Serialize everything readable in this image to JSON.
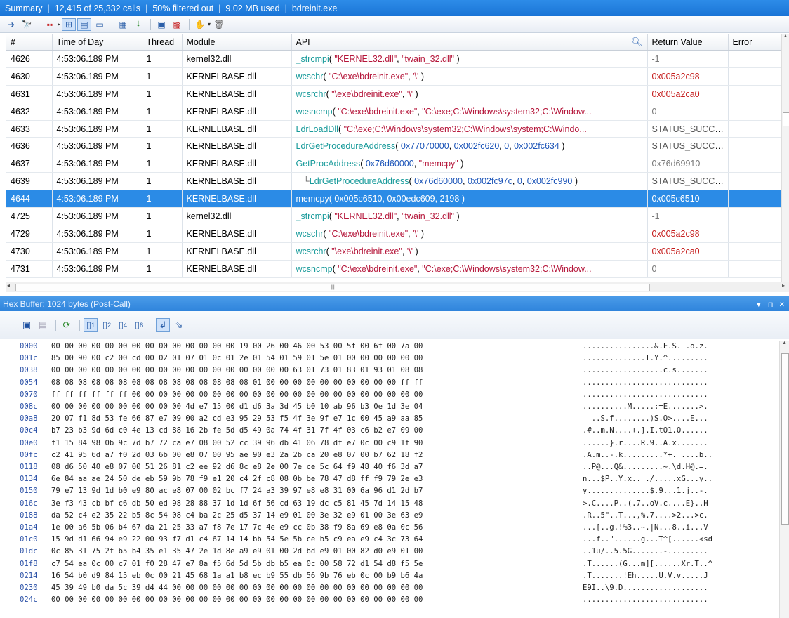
{
  "summary": {
    "label": "Summary",
    "calls": "12,415 of 25,332 calls",
    "filtered": "50% filtered out",
    "memory": "9.02 MB used",
    "process": "bdreinit.exe"
  },
  "columns": [
    "#",
    "Time of Day",
    "Thread",
    "Module",
    "API",
    "Return Value",
    "Error"
  ],
  "rows": [
    {
      "n": "4626",
      "time": "4:53:06.189 PM",
      "thread": "1",
      "module": "kernel32.dll",
      "fn": "_strcmpi",
      "args": [
        {
          "t": "( ",
          "k": "p"
        },
        {
          "t": "\"KERNEL32.dll\"",
          "k": "s"
        },
        {
          "t": ", ",
          "k": "p"
        },
        {
          "t": "\"twain_32.dll\"",
          "k": "s"
        },
        {
          "t": " )",
          "k": "p"
        }
      ],
      "ret": "-1",
      "retk": "d"
    },
    {
      "n": "4630",
      "time": "4:53:06.189 PM",
      "thread": "1",
      "module": "KERNELBASE.dll",
      "fn": "wcschr",
      "args": [
        {
          "t": "( ",
          "k": "p"
        },
        {
          "t": "\"C:\\exe\\bdreinit.exe\"",
          "k": "s"
        },
        {
          "t": ", ",
          "k": "p"
        },
        {
          "t": "'\\'",
          "k": "s"
        },
        {
          "t": " )",
          "k": "p"
        }
      ],
      "ret": "0x005a2c98",
      "retk": "h"
    },
    {
      "n": "4631",
      "time": "4:53:06.189 PM",
      "thread": "1",
      "module": "KERNELBASE.dll",
      "fn": "wcsrchr",
      "args": [
        {
          "t": "( ",
          "k": "p"
        },
        {
          "t": "\"\\exe\\bdreinit.exe\"",
          "k": "s"
        },
        {
          "t": ", ",
          "k": "p"
        },
        {
          "t": "'\\'",
          "k": "s"
        },
        {
          "t": " )",
          "k": "p"
        }
      ],
      "ret": "0x005a2ca0",
      "retk": "h"
    },
    {
      "n": "4632",
      "time": "4:53:06.189 PM",
      "thread": "1",
      "module": "KERNELBASE.dll",
      "fn": "wcsncmp",
      "args": [
        {
          "t": "( ",
          "k": "p"
        },
        {
          "t": "\"C:\\exe\\bdreinit.exe\"",
          "k": "s"
        },
        {
          "t": ", ",
          "k": "p"
        },
        {
          "t": "\"C:\\exe;C:\\Windows\\system32;C:\\Window...",
          "k": "s"
        }
      ],
      "ret": "0",
      "retk": "d"
    },
    {
      "n": "4633",
      "time": "4:53:06.189 PM",
      "thread": "1",
      "module": "KERNELBASE.dll",
      "fn": "LdrLoadDll",
      "args": [
        {
          "t": "( ",
          "k": "p"
        },
        {
          "t": "\"C:\\exe;C:\\Windows\\system32;C:\\Windows\\system;C:\\Windo...",
          "k": "s"
        }
      ],
      "ret": "STATUS_SUCCESS",
      "retk": "o"
    },
    {
      "n": "4636",
      "time": "4:53:06.189 PM",
      "thread": "1",
      "module": "KERNELBASE.dll",
      "fn": "LdrGetProcedureAddress",
      "args": [
        {
          "t": "( ",
          "k": "p"
        },
        {
          "t": "0x77070000",
          "k": "n"
        },
        {
          "t": ", ",
          "k": "p"
        },
        {
          "t": "0x002fc620",
          "k": "n"
        },
        {
          "t": ", ",
          "k": "p"
        },
        {
          "t": "0",
          "k": "n"
        },
        {
          "t": ", ",
          "k": "p"
        },
        {
          "t": "0x002fc634",
          "k": "n"
        },
        {
          "t": " )",
          "k": "p"
        }
      ],
      "ret": "STATUS_SUCCESS",
      "retk": "o"
    },
    {
      "n": "4637",
      "time": "4:53:06.189 PM",
      "thread": "1",
      "module": "KERNELBASE.dll",
      "fn": "GetProcAddress",
      "args": [
        {
          "t": "( ",
          "k": "p"
        },
        {
          "t": "0x76d60000",
          "k": "n"
        },
        {
          "t": ", ",
          "k": "p"
        },
        {
          "t": "\"memcpy\"",
          "k": "s"
        },
        {
          "t": " )",
          "k": "p"
        }
      ],
      "ret": "0x76d69910",
      "retk": "d"
    },
    {
      "n": "4639",
      "time": "4:53:06.189 PM",
      "thread": "1",
      "module": "KERNELBASE.dll",
      "child": true,
      "fn": "LdrGetProcedureAddress",
      "args": [
        {
          "t": "( ",
          "k": "p"
        },
        {
          "t": "0x76d60000",
          "k": "n"
        },
        {
          "t": ", ",
          "k": "p"
        },
        {
          "t": "0x002fc97c",
          "k": "n"
        },
        {
          "t": ", ",
          "k": "p"
        },
        {
          "t": "0",
          "k": "n"
        },
        {
          "t": ", ",
          "k": "p"
        },
        {
          "t": "0x002fc990",
          "k": "n"
        },
        {
          "t": " )",
          "k": "p"
        }
      ],
      "ret": "STATUS_SUCCESS",
      "retk": "o"
    },
    {
      "n": "4644",
      "time": "4:53:06.189 PM",
      "thread": "1",
      "module": "KERNELBASE.dll",
      "selected": true,
      "fn": "memcpy",
      "args": [
        {
          "t": "( ",
          "k": "p"
        },
        {
          "t": "0x005c6510",
          "k": "n"
        },
        {
          "t": ", ",
          "k": "p"
        },
        {
          "t": "0x00edc609",
          "k": "n"
        },
        {
          "t": ", ",
          "k": "p"
        },
        {
          "t": "2198",
          "k": "n"
        },
        {
          "t": " )",
          "k": "p"
        }
      ],
      "ret": "0x005c6510",
      "retk": "h"
    },
    {
      "n": "4725",
      "time": "4:53:06.189 PM",
      "thread": "1",
      "module": "kernel32.dll",
      "fn": "_strcmpi",
      "args": [
        {
          "t": "( ",
          "k": "p"
        },
        {
          "t": "\"KERNEL32.dll\"",
          "k": "s"
        },
        {
          "t": ", ",
          "k": "p"
        },
        {
          "t": "\"twain_32.dll\"",
          "k": "s"
        },
        {
          "t": " )",
          "k": "p"
        }
      ],
      "ret": "-1",
      "retk": "d"
    },
    {
      "n": "4729",
      "time": "4:53:06.189 PM",
      "thread": "1",
      "module": "KERNELBASE.dll",
      "fn": "wcschr",
      "args": [
        {
          "t": "( ",
          "k": "p"
        },
        {
          "t": "\"C:\\exe\\bdreinit.exe\"",
          "k": "s"
        },
        {
          "t": ", ",
          "k": "p"
        },
        {
          "t": "'\\'",
          "k": "s"
        },
        {
          "t": " )",
          "k": "p"
        }
      ],
      "ret": "0x005a2c98",
      "retk": "h"
    },
    {
      "n": "4730",
      "time": "4:53:06.189 PM",
      "thread": "1",
      "module": "KERNELBASE.dll",
      "fn": "wcsrchr",
      "args": [
        {
          "t": "( ",
          "k": "p"
        },
        {
          "t": "\"\\exe\\bdreinit.exe\"",
          "k": "s"
        },
        {
          "t": ", ",
          "k": "p"
        },
        {
          "t": "'\\'",
          "k": "s"
        },
        {
          "t": " )",
          "k": "p"
        }
      ],
      "ret": "0x005a2ca0",
      "retk": "h"
    },
    {
      "n": "4731",
      "time": "4:53:06.189 PM",
      "thread": "1",
      "module": "KERNELBASE.dll",
      "fn": "wcsncmp",
      "args": [
        {
          "t": "( ",
          "k": "p"
        },
        {
          "t": "\"C:\\exe\\bdreinit.exe\"",
          "k": "s"
        },
        {
          "t": ", ",
          "k": "p"
        },
        {
          "t": "\"C:\\exe;C:\\Windows\\system32;C:\\Window...",
          "k": "s"
        }
      ],
      "ret": "0",
      "retk": "d"
    }
  ],
  "hex": {
    "title": "Hex Buffer: 1024 bytes (Post-Call)",
    "rows": [
      {
        "off": "0000",
        "bytes": "00 00 00 00 00 00 00 00 00 00 00 00 00 00 19 00 26 00 46 00 53 00 5f 00 6f 00 7a 00",
        "ascii": "................&.F.S._.o.z."
      },
      {
        "off": "001c",
        "bytes": "85 00 90 00 c2 00 cd 00 02 01 07 01 0c 01 2e 01 54 01 59 01 5e 01 00 00 00 00 00 00",
        "ascii": "..............T.Y.^........."
      },
      {
        "off": "0038",
        "bytes": "00 00 00 00 00 00 00 00 00 00 00 00 00 00 00 00 00 00 63 01 73 01 83 01 93 01 08 08",
        "ascii": "..................c.s......."
      },
      {
        "off": "0054",
        "bytes": "08 08 08 08 08 08 08 08 08 08 08 08 08 08 08 01 00 00 00 00 00 00 00 00 00 00 ff ff",
        "ascii": "............................"
      },
      {
        "off": "0070",
        "bytes": "ff ff ff ff ff ff 00 00 00 00 00 00 00 00 00 00 00 00 00 00 00 00 00 00 00 00 00 00",
        "ascii": "............................"
      },
      {
        "off": "008c",
        "bytes": "00 00 00 00 00 00 00 00 00 00 4d e7 15 00 d1 d6 3a 3d 45 b0 10 ab 96 b3 0e 1d 3e 04",
        "ascii": "..........M.....:=E.......>."
      },
      {
        "off": "00a8",
        "bytes": "20 07 f1 8d 53 fe 66 87 e7 09 00 a2 cd e3 95 29 53 f5 4f 3e 9f e7 1c 00 45 a9 aa 85",
        "ascii": "  ..S.f........)S.O>....E..."
      },
      {
        "off": "00c4",
        "bytes": "b7 23 b3 9d 6d c0 4e 13 cd 88 16 2b fe 5d d5 49 0a 74 4f 31 7f 4f 03 c6 b2 e7 09 00",
        "ascii": ".#..m.N....+.].I.tO1.O......"
      },
      {
        "off": "00e0",
        "bytes": "f1 15 84 98 0b 9c 7d b7 72 ca e7 08 00 52 cc 39 96 db 41 06 78 df e7 0c 00 c9 1f 90",
        "ascii": "......}.r....R.9..A.x......."
      },
      {
        "off": "00fc",
        "bytes": "c2 41 95 6d a7 f0 2d 03 6b 00 e8 07 00 95 ae 90 e3 2a 2b ca 20 e8 07 00 b7 62 18 f2",
        "ascii": ".A.m..-.k.........*+. ....b.."
      },
      {
        "off": "0118",
        "bytes": "08 d6 50 40 e8 07 00 51 26 81 c2 ee 92 d6 8c e8 2e 00 7e ce 5c 64 f9 48 40 f6 3d a7",
        "ascii": "..P@...Q&.........~.\\d.H@.=."
      },
      {
        "off": "0134",
        "bytes": "6e 84 aa ae 24 50 de eb 59 9b 78 f9 e1 20 c4 2f c8 08 0b be 78 47 d8 ff f9 79 2e e3",
        "ascii": "n...$P..Y.x.. ./.....xG...y.."
      },
      {
        "off": "0150",
        "bytes": "79 e7 13 9d 1d b0 e9 80 ac e8 07 00 02 bc f7 24 a3 39 97 e8 e8 31 00 6a 96 d1 2d b7",
        "ascii": "y..............$.9...1.j..-."
      },
      {
        "off": "016c",
        "bytes": "3e f3 43 cb bf c6 db 50 ed 98 28 88 37 1d 1d 6f 56 cd 63 19 dc c5 81 45 7d 14 15 48",
        "ascii": ">.C....P..(.7..oV.c....E}..H"
      },
      {
        "off": "0188",
        "bytes": "da 52 c4 e2 35 22 b5 8c 54 08 c4 ba 2c 25 d5 37 14 e9 01 00 3e 32 e9 01 00 3e 63 e9",
        "ascii": ".R..5\"..T...,%.7....>2...>c."
      },
      {
        "off": "01a4",
        "bytes": "1e 00 a6 5b 06 b4 67 da 21 25 33 a7 f8 7e 17 7c 4e e9 cc 0b 38 f9 8a 69 e8 0a 0c 56",
        "ascii": "...[..g.!%3..~.|N...8..i...V"
      },
      {
        "off": "01c0",
        "bytes": "15 9d d1 66 94 e9 22 00 93 f7 d1 c4 67 14 14 bb 54 5e 5b ce b5 c9 ea e9 c4 3c 73 64",
        "ascii": "...f..\"......g...T^[......<sd"
      },
      {
        "off": "01dc",
        "bytes": "0c 85 31 75 2f b5 b4 35 e1 35 47 2e 1d 8e a9 e9 01 00 2d bd e9 01 00 82 d0 e9 01 00",
        "ascii": "..1u/..5.5G.......-........."
      },
      {
        "off": "01f8",
        "bytes": "c7 54 ea 0c 00 c7 01 f0 28 47 e7 8a f5 6d 5d 5b db b5 ea 0c 00 58 72 d1 54 d8 f5 5e",
        "ascii": ".T......(G...m][......Xr.T..^"
      },
      {
        "off": "0214",
        "bytes": "16 54 b0 d9 84 15 eb 0c 00 21 45 68 1a a1 b8 ec b9 55 db 56 9b 76 eb 0c 00 b9 b6 4a",
        "ascii": ".T.......!Eh.....U.V.v.....J"
      },
      {
        "off": "0230",
        "bytes": "45 39 49 b0 da 5c 39 d4 44 00 00 00 00 00 00 00 00 00 00 00 00 00 00 00 00 00 00 00",
        "ascii": "E9I..\\9.D..................."
      },
      {
        "off": "024c",
        "bytes": "00 00 00 00 00 00 00 00 00 00 00 00 00 00 00 00 00 00 00 00 00 00 00 00 00 00 00 00",
        "ascii": "............................"
      }
    ]
  },
  "icons": [
    "arrow-right-icon",
    "find-icon",
    "columns-icon",
    "tree-view-icon",
    "filter-icon",
    "window-icon",
    "table-icon",
    "export-icon",
    "copy-icon",
    "excel-icon",
    "hand-icon",
    "trash-icon"
  ],
  "colors": {
    "title_bar": "#1a74d6",
    "selection": "#2b8be6",
    "fn": "#179a9a",
    "string": "#b5173b",
    "number": "#1b54b8",
    "ret_hex": "#c51b1b"
  }
}
